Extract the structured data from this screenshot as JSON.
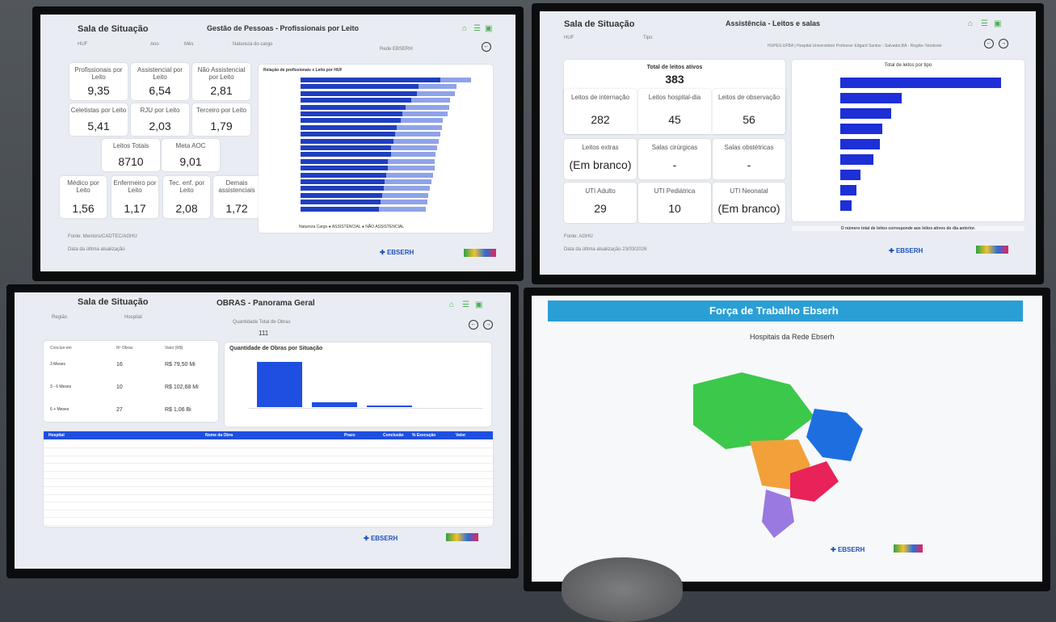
{
  "screen1": {
    "title": "Sala de Situação",
    "subtitle": "Gestão de Pessoas - Profissionais por Leito",
    "filters": [
      "HUF",
      "Ano",
      "Mês",
      "Natureza do cargo",
      "Rede EBSERH"
    ],
    "kpis": [
      {
        "label": "Profissionais por Leito",
        "value": "9,35"
      },
      {
        "label": "Assistencial por Leito",
        "value": "6,54"
      },
      {
        "label": "Não Assistencial por Leito",
        "value": "2,81"
      },
      {
        "label": "Celetistas por Leito",
        "value": "5,41"
      },
      {
        "label": "RJU por Leito",
        "value": "2,03"
      },
      {
        "label": "Terceiro por Leito",
        "value": "1,79"
      },
      {
        "label": "Leitos Totais",
        "value": "8710"
      },
      {
        "label": "Meta AOC",
        "value": "9,01"
      },
      {
        "label": "Médico por Leito",
        "value": "1,56"
      },
      {
        "label": "Enfermeiro por Leito",
        "value": "1,17"
      },
      {
        "label": "Tec. enf. por Leito",
        "value": "2,08"
      },
      {
        "label": "Demais assistenciais",
        "value": "1,72"
      }
    ],
    "chart_title": "Relação de profissionais x Leito por HUF",
    "chart_legend": "Natureza Cargo ● ASSISTENCIAL ● NÃO ASSISTENCIAL",
    "source": "Fonte: Mentors/CADTEC/AGHU",
    "updated": "Data da última atualização"
  },
  "screen2": {
    "title": "Sala de Situação",
    "subtitle": "Assistência - Leitos e salas",
    "filters": [
      "HUF",
      "Tipo"
    ],
    "header_note": "HUPES-UFBA | Hospital Universitário Professor Edgard Santos - Salvador,BA - Região: Nordeste",
    "total_label": "Total de leitos ativos",
    "total_value": "383",
    "kpis": [
      {
        "label": "Leitos de internação",
        "value": "282"
      },
      {
        "label": "Leitos hospital-dia",
        "value": "45"
      },
      {
        "label": "Leitos de observação",
        "value": "56"
      },
      {
        "label": "Leitos extras",
        "value": "(Em branco)"
      },
      {
        "label": "Salas cirúrgicas",
        "value": "-"
      },
      {
        "label": "Salas obstétricas",
        "value": "-"
      },
      {
        "label": "UTI Adulto",
        "value": "29"
      },
      {
        "label": "UTI Pediátrica",
        "value": "10"
      },
      {
        "label": "UTI Neonatal",
        "value": "(Em branco)"
      }
    ],
    "chart_title": "Total de leitos por tipo",
    "footnote": "O número total de leitos corresponde aos leitos ativos do dia anterior.",
    "source": "Fonte: AGHU",
    "updated": "Data da última atualização 23/03/2026"
  },
  "screen3": {
    "title": "Sala de Situação",
    "subtitle": "OBRAS - Panorama Geral",
    "filters": [
      "Região",
      "Hospital"
    ],
    "total_label": "Quantidade Total de Obras",
    "total_value": "111",
    "table_headers": [
      "Concluir em",
      "Nº Obras",
      "Valor (R$)"
    ],
    "rows": [
      {
        "period": "3 Meses",
        "count": "16",
        "value": "R$ 79,50 Mi"
      },
      {
        "period": "3 - 6 Meses",
        "count": "10",
        "value": "R$ 102,68 Mi"
      },
      {
        "period": "6 + Meses",
        "count": "27",
        "value": "R$ 1,06 Bi"
      }
    ],
    "chart_title": "Quantidade de Obras por Situação",
    "list_headers": [
      "Hospital",
      "Nome da Obra",
      "Prazo",
      "Conclusão",
      "% Execução",
      "Valor"
    ]
  },
  "screen4": {
    "title": "Força de Trabalho Ebserh",
    "subtitle": "Hospitais da Rede Ebserh"
  },
  "brand": {
    "name": "EBSERH"
  },
  "colors": {
    "bar_dark": "#1f3fbf",
    "bar_light": "#8fa3e8",
    "header_blue": "#2a9fd6",
    "region_north": "#3cc84a",
    "region_northeast": "#1d6fe0",
    "region_centerwest": "#f2a13a",
    "region_southeast": "#e8235a",
    "region_south": "#9a79e0"
  }
}
